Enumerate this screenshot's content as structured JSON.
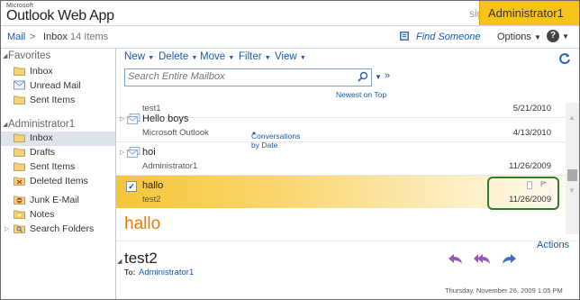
{
  "app": {
    "brand_top": "Microsoft",
    "title": "Outlook Web App",
    "sign_out": "sign out",
    "account": "Administrator1"
  },
  "breadcrumb": {
    "mail": "Mail",
    "separator": ">",
    "folder": "Inbox",
    "count": "14 Items",
    "find_someone": "Find Someone",
    "options": "Options",
    "help": "?"
  },
  "sidebar": {
    "favorites_label": "Favorites",
    "favorites": [
      {
        "label": "Inbox",
        "icon": "folder-icon"
      },
      {
        "label": "Unread Mail",
        "icon": "unread-mail-icon"
      },
      {
        "label": "Sent Items",
        "icon": "folder-icon"
      }
    ],
    "mailbox_label": "Administrator1",
    "folders": [
      {
        "label": "Inbox",
        "icon": "folder-icon",
        "selected": true
      },
      {
        "label": "Drafts",
        "icon": "folder-icon"
      },
      {
        "label": "Sent Items",
        "icon": "folder-icon"
      },
      {
        "label": "Deleted Items",
        "icon": "deleted-items-icon"
      },
      {
        "label": "Junk E-Mail",
        "icon": "junk-mail-icon"
      },
      {
        "label": "Notes",
        "icon": "notes-icon"
      },
      {
        "label": "Search Folders",
        "icon": "search-folders-icon"
      }
    ]
  },
  "toolbar": {
    "new": "New",
    "delete": "Delete",
    "move": "Move",
    "filter": "Filter",
    "view": "View"
  },
  "search": {
    "placeholder": "Search Entire Mailbox"
  },
  "sort": {
    "by": "Conversations by Date",
    "order": "Newest on Top"
  },
  "messages": [
    {
      "subject": "",
      "from": "test1",
      "date": "5/21/2010"
    },
    {
      "subject": "Hello boys",
      "from": "Microsoft Outlook",
      "date": "4/13/2010"
    },
    {
      "subject": "hoi",
      "from": "Administrator1",
      "date": "11/26/2009"
    },
    {
      "subject": "hallo",
      "from": "test2",
      "date": "11/26/2009",
      "selected": true
    }
  ],
  "reading_pane": {
    "subject": "hallo",
    "actions": "Actions",
    "sender": "test2",
    "to_label": "To:",
    "to": "Administrator1",
    "sent": "Thursday, November 26, 2009 1:05 PM"
  },
  "colors": {
    "accent_yellow": "#f7c21b",
    "link_blue": "#1a5aa8",
    "subject_orange": "#e8790a",
    "highlight_green": "#2f7d2f"
  }
}
